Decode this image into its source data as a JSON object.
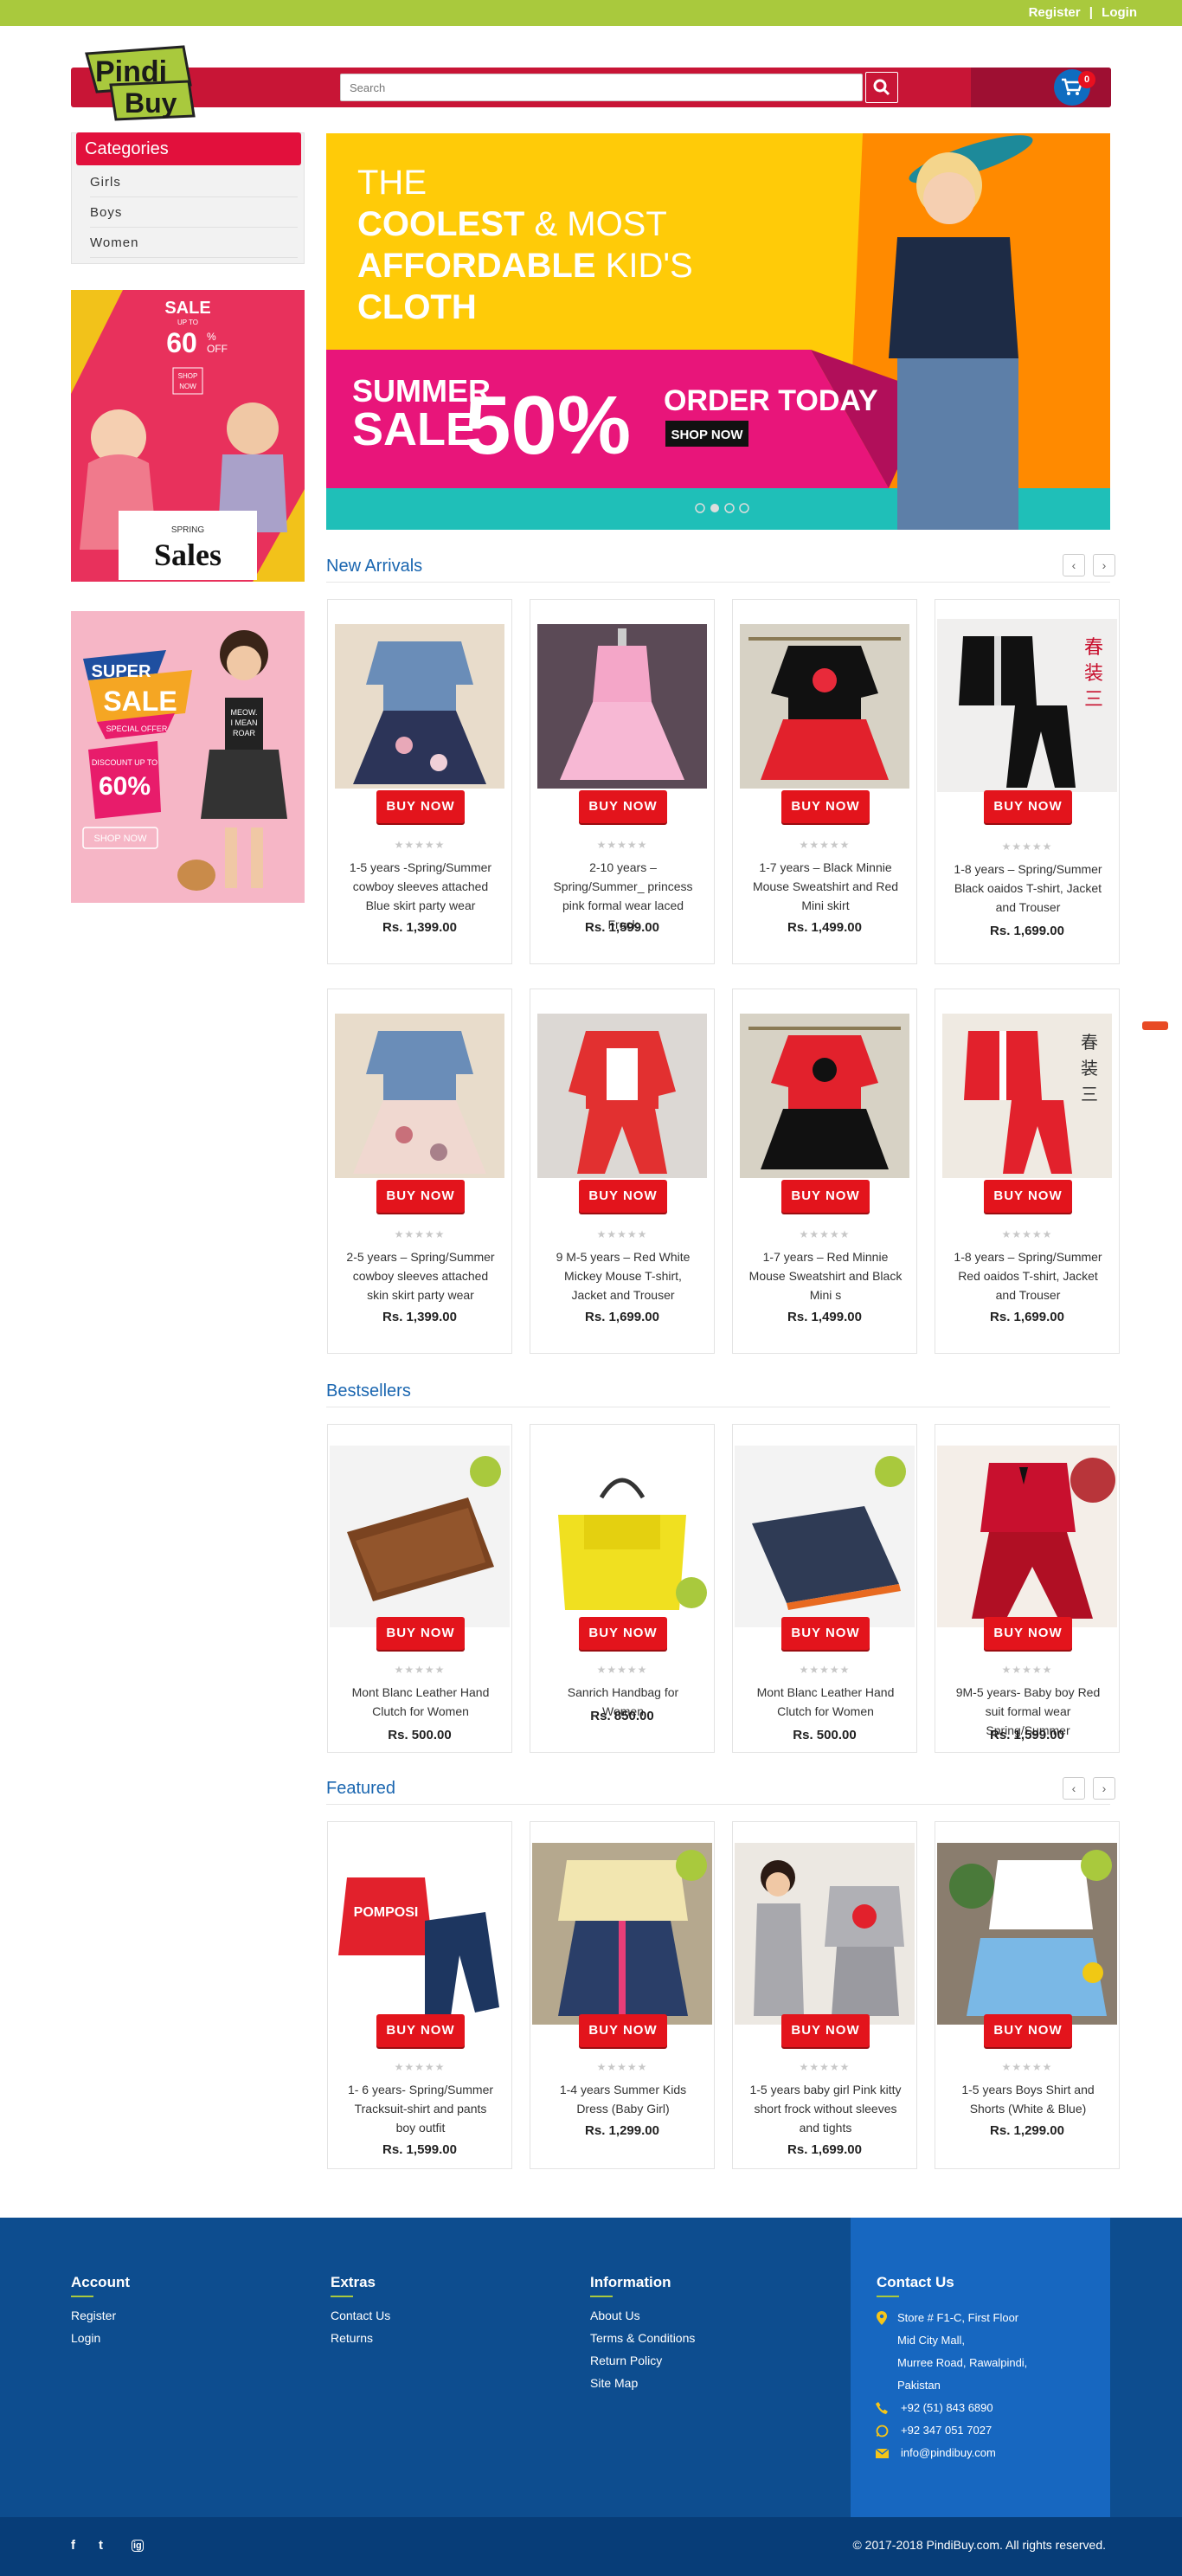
{
  "topbar": {
    "register": "Register",
    "separator": "|",
    "login": "Login"
  },
  "logo": {
    "line1": "Pindi",
    "line2": "Buy"
  },
  "search": {
    "placeholder": "Search"
  },
  "cart": {
    "count": "0"
  },
  "categories": {
    "title": "Categories",
    "items": [
      "Girls",
      "Boys",
      "Women"
    ]
  },
  "promo1": {
    "sale": "SALE",
    "upto": "UP TO",
    "pct": "60",
    "pct_sign": "%",
    "off": "OFF",
    "shop": "SHOP",
    "now": "NOW",
    "spring": "SPRING",
    "sales": "Sales"
  },
  "promo2": {
    "super": "SUPER",
    "sale": "SALE",
    "special": "SPECIAL OFFER",
    "discount": "DISCOUNT UP TO",
    "pct": "60%",
    "shop": "SHOP NOW",
    "shirt1": "MEOW.",
    "shirt2": "I MEAN",
    "shirt3": "ROAR"
  },
  "hero": {
    "line1": "THE",
    "line2a": "COOLEST",
    "line2b": " & MOST",
    "line3a": "AFFORDABLE",
    "line3b": " KID'S",
    "line4": "CLOTH",
    "summer": "SUMMER",
    "sale": "SALE",
    "pct": "50%",
    "order": "ORDER TODAY",
    "shop": "SHOP NOW"
  },
  "sections": {
    "new_arrivals": "New Arrivals",
    "bestsellers": "Bestsellers",
    "featured": "Featured"
  },
  "buy_label": "BUY NOW",
  "stars": "★★★★★",
  "new_arrivals": [
    {
      "name": "1-5 years -Spring/Summer cowboy sleeves attached Blue skirt party wear",
      "price": "Rs. 1,399.00"
    },
    {
      "name": "2-10 years – Spring/Summer_ princess pink formal wear laced Frock",
      "price": "Rs. 1,599.00"
    },
    {
      "name": "1-7 years – Black Minnie Mouse Sweatshirt and Red Mini skirt",
      "price": "Rs. 1,499.00"
    },
    {
      "name": "1-8 years – Spring/Summer Black oaidos T-shirt, Jacket and Trouser",
      "price": "Rs. 1,699.00"
    },
    {
      "name": "2-5 years – Spring/Summer cowboy sleeves attached skin skirt party wear",
      "price": "Rs. 1,399.00"
    },
    {
      "name": "9 M-5 years – Red White Mickey Mouse T-shirt, Jacket and Trouser",
      "price": "Rs. 1,699.00"
    },
    {
      "name": "1-7 years – Red Minnie Mouse Sweatshirt and Black Mini s",
      "price": "Rs. 1,499.00"
    },
    {
      "name": "1-8 years – Spring/Summer Red oaidos T-shirt, Jacket and Trouser",
      "price": "Rs. 1,699.00"
    }
  ],
  "bestsellers": [
    {
      "name": "Mont Blanc Leather Hand Clutch for Women",
      "price": "Rs. 500.00"
    },
    {
      "name": "Sanrich Handbag for Women",
      "price": "Rs. 850.00"
    },
    {
      "name": "Mont Blanc Leather Hand Clutch for Women",
      "price": "Rs. 500.00"
    },
    {
      "name": "9M-5 years- Baby boy Red suit formal wear Spring/Summer",
      "price": "Rs. 1,599.00"
    }
  ],
  "featured": [
    {
      "name": "1- 6 years- Spring/Summer Tracksuit-shirt and pants boy outfit",
      "price": "Rs. 1,599.00",
      "print": "POMPOSI"
    },
    {
      "name": "1-4 years Summer Kids Dress (Baby Girl)",
      "price": "Rs. 1,299.00"
    },
    {
      "name": "1-5 years baby girl Pink kitty short frock without sleeves and tights",
      "price": "Rs. 1,699.00"
    },
    {
      "name": "1-5 years Boys Shirt and Shorts (White & Blue)",
      "price": "Rs. 1,299.00"
    }
  ],
  "footer": {
    "account": {
      "title": "Account",
      "links": [
        "Register",
        "Login"
      ]
    },
    "extras": {
      "title": "Extras",
      "links": [
        "Contact Us",
        "Returns"
      ]
    },
    "information": {
      "title": "Information",
      "links": [
        "About Us",
        "Terms & Conditions",
        "Return Policy",
        "Site Map"
      ]
    },
    "contact": {
      "title": "Contact Us",
      "address": [
        "Store # F1-C, First Floor",
        "Mid City Mall,",
        "Murree Road, Rawalpindi,",
        "Pakistan"
      ],
      "phone": "+92 (51) 843 6890",
      "whatsapp": "+92 347 051 7027",
      "email": "info@pindibuy.com"
    },
    "copyright": "© 2017-2018 PindiBuy.com. All rights reserved.",
    "social": [
      "f",
      "t",
      "ig"
    ]
  },
  "colors": {
    "topbar": "#a9c93d",
    "header": "#c81536",
    "accent_blue": "#1a66b0",
    "buy_button": "#e3141c",
    "footer": "#0d4d8f"
  }
}
